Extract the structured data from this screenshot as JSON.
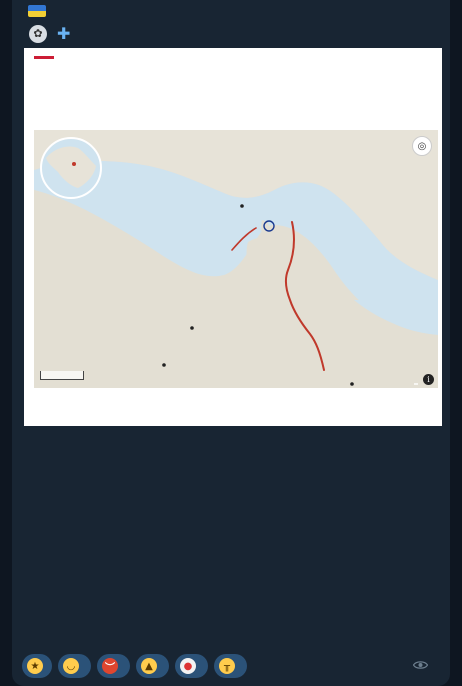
{
  "message": {
    "sender": "",
    "forwarded_label": "",
    "forwarded_from": "",
    "views": "",
    "time": ""
  },
  "graphic": {
    "title": "",
    "subtitle": "",
    "logo_text": "",
    "sources": "",
    "map": {
      "places": {
        "bandar_abbas": "",
        "larak_island": "",
        "dubai": "",
        "abu_dhabi": "",
        "muscat": ""
      },
      "countries": {
        "iran": "",
        "uae": "",
        "oman": ""
      },
      "seas": {
        "strait": "",
        "gulf": "",
        "gulf_of_oman": ""
      },
      "route_label": "",
      "route_color": "#c0392b",
      "scale": "",
      "attribution": ""
    }
  },
  "post": {
    "headline_before": "",
    "headline_link": "",
    "headline_after": "",
    "paragraph_1": "",
    "paragraph_2": ""
  },
  "footer_links": {
    "channel": "",
    "separator": "",
    "monobase": ""
  },
  "reactions": [
    {
      "icon": "star-icon",
      "count": ""
    },
    {
      "icon": "grinning-face-icon",
      "count": ""
    },
    {
      "icon": "angry-face-icon",
      "count": ""
    },
    {
      "icon": "thumbs-up-icon",
      "count": ""
    },
    {
      "icon": "clown-face-icon",
      "count": ""
    },
    {
      "icon": "crying-face-icon",
      "count": ""
    }
  ],
  "colors": {
    "background": "#0e1621",
    "bubble": "#182533",
    "link": "#6ab3f3",
    "sender": "#f0a24b",
    "reaction_pill": "#2b5278"
  }
}
